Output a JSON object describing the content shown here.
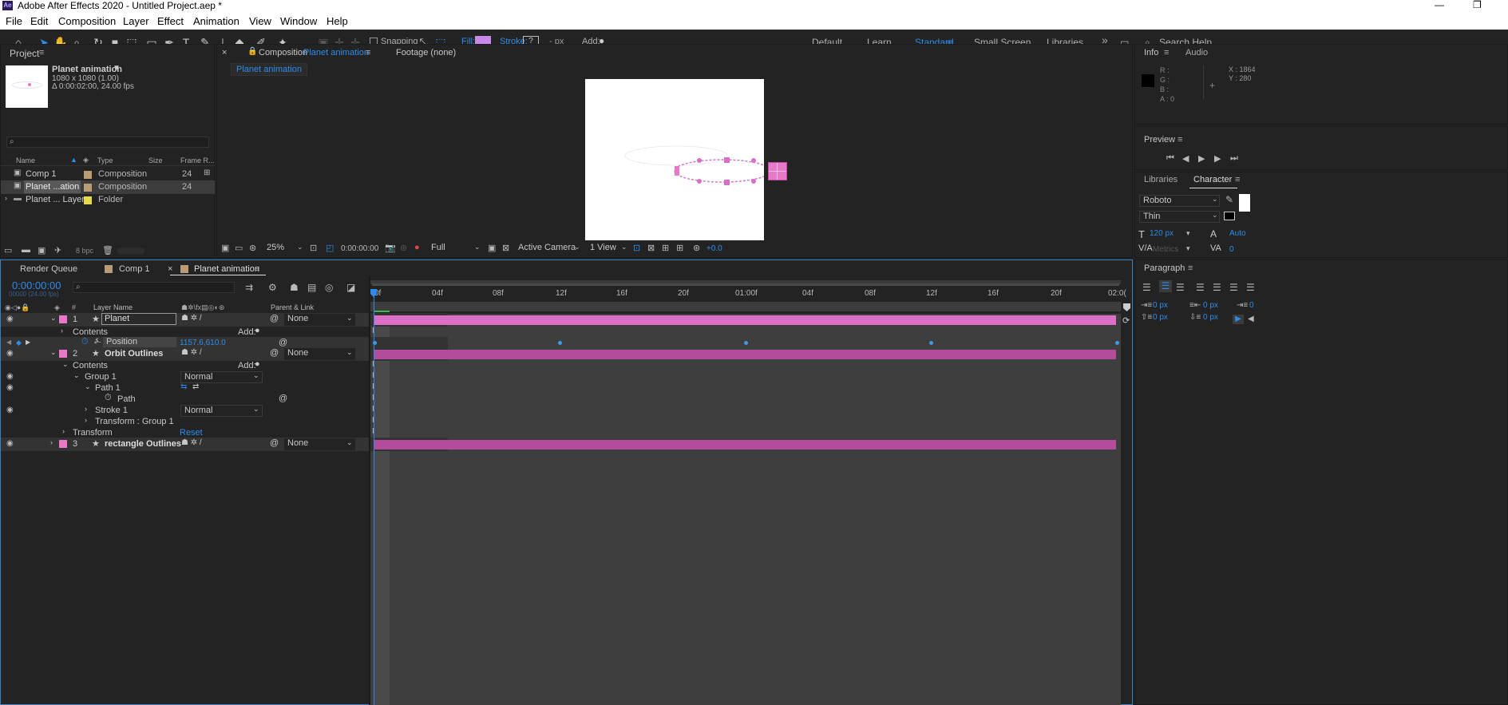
{
  "window": {
    "title": "Adobe After Effects 2020 - Untitled Project.aep *",
    "logo_text": "Ae",
    "minimize_glyph": "—",
    "restore_glyph": "❐"
  },
  "menu": [
    "File",
    "Edit",
    "Composition",
    "Layer",
    "Effect",
    "Animation",
    "View",
    "Window",
    "Help"
  ],
  "toolbar": {
    "snapping_label": "Snapping",
    "fill_label": "Fill:",
    "stroke_label": "Stroke:",
    "stroke_value": "?",
    "stroke_unit": "- px",
    "add_label": "Add:",
    "fill_color": "#c78ae8",
    "workspaces": [
      "Default",
      "Learn",
      "Standard",
      "Small Screen",
      "Libraries"
    ],
    "active_workspace": "Standard",
    "more_glyph": "»",
    "search_placeholder": "Search Help"
  },
  "project": {
    "tab": "Project",
    "item_name": "Planet animation",
    "item_dims": "1080 x 1080 (1.00)",
    "item_duration": "Δ 0:00:02:00, 24.00 fps",
    "columns": [
      "Name",
      "Type",
      "Size",
      "Frame R..."
    ],
    "rows": [
      {
        "name": "Comp 1",
        "type": "Composition",
        "frame": "24",
        "label_color": "#b79c75"
      },
      {
        "name": "Planet ...ation",
        "type": "Composition",
        "frame": "24",
        "label_color": "#b79c75"
      },
      {
        "name": "Planet ... Layers",
        "type": "Folder",
        "frame": "",
        "label_color": "#e6d84c"
      }
    ],
    "bpc": "8 bpc"
  },
  "composition": {
    "tab_prefix": "Composition",
    "tab_name": "Planet animation",
    "footage_tab": "Footage (none)",
    "crumb": "Planet animation",
    "zoom": "25%",
    "timecode": "0:00:00:00",
    "resolution": "Full",
    "camera": "Active Camera",
    "view": "1 View",
    "exposure": "+0.0"
  },
  "info": {
    "tab": "Info",
    "audio_tab": "Audio",
    "r": "R :",
    "g": "G :",
    "b": "B :",
    "a": "A : 0",
    "x": "X : 1864",
    "y": "Y : 280"
  },
  "preview": {
    "tab": "Preview"
  },
  "libraries": {
    "tab": "Libraries"
  },
  "character": {
    "tab": "Character",
    "font": "Roboto",
    "style": "Thin",
    "size": "120 px",
    "leading": "Auto",
    "kerning": "Metrics",
    "tracking": "0"
  },
  "paragraph": {
    "tab": "Paragraph",
    "indent1": "0 px",
    "indent2": "0 px",
    "indent3": "0",
    "space1": "0 px",
    "space2": "0 px"
  },
  "timeline": {
    "tabs": [
      "Render Queue",
      "Comp 1",
      "Planet animation"
    ],
    "timecode": "0:00:00:00",
    "sub_timecode": "00000 (24.00 fps)",
    "col_layer_name": "Layer Name",
    "col_parent": "Parent & Link",
    "ticks": [
      "0f",
      "04f",
      "08f",
      "12f",
      "16f",
      "20f",
      "01:00f",
      "04f",
      "08f",
      "12f",
      "16f",
      "20f",
      "02:0("
    ],
    "rows": [
      {
        "num": "1",
        "name": "Planet",
        "parent": "None"
      },
      {
        "label": "Contents",
        "add": "Add:"
      },
      {
        "label": "Position",
        "value": "1157.6,610.0"
      },
      {
        "num": "2",
        "name": "Orbit Outlines",
        "parent": "None"
      },
      {
        "label": "Contents",
        "add": "Add:"
      },
      {
        "label": "Group 1",
        "mode": "Normal"
      },
      {
        "label": "Path 1"
      },
      {
        "label": "Path"
      },
      {
        "label": "Stroke 1",
        "mode": "Normal"
      },
      {
        "label": "Transform : Group 1"
      },
      {
        "label": "Transform",
        "action": "Reset"
      },
      {
        "num": "3",
        "name": "rectangle Outlines",
        "parent": "None"
      }
    ],
    "layer_color": "#e879c8",
    "bar_color_1": "#d865be",
    "bar_color_2": "#b7509f"
  }
}
